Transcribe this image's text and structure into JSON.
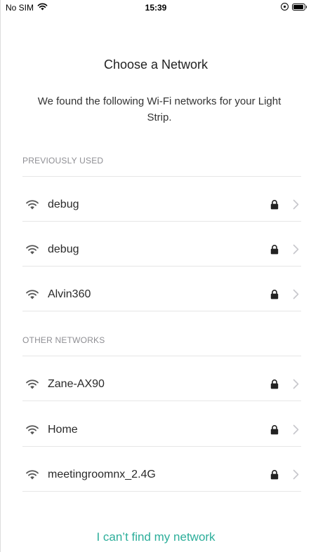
{
  "status_bar": {
    "carrier": "No SIM",
    "time": "15:39",
    "battery_level": 0.9
  },
  "title": "Choose a Network",
  "subtitle": "We found the following Wi-Fi networks for your Light Strip.",
  "sections": [
    {
      "header": "PREVIOUSLY USED",
      "networks": [
        {
          "name": "debug",
          "secured": true
        },
        {
          "name": "debug",
          "secured": true
        },
        {
          "name": "Alvin360",
          "secured": true
        }
      ]
    },
    {
      "header": "OTHER NETWORKS",
      "networks": [
        {
          "name": "Zane-AX90",
          "secured": true
        },
        {
          "name": "Home",
          "secured": true
        },
        {
          "name": "meetingroomnx_2.4G",
          "secured": true
        }
      ]
    }
  ],
  "cant_find_label": "I can’t find my network",
  "colors": {
    "accent": "#2cae9a",
    "section_header": "#8e8e93",
    "divider": "#e6e6e6"
  },
  "icons": {
    "row_icon": "wifi-icon",
    "secure_icon": "padlock-icon",
    "disclosure_icon": "chevron-right-icon"
  }
}
